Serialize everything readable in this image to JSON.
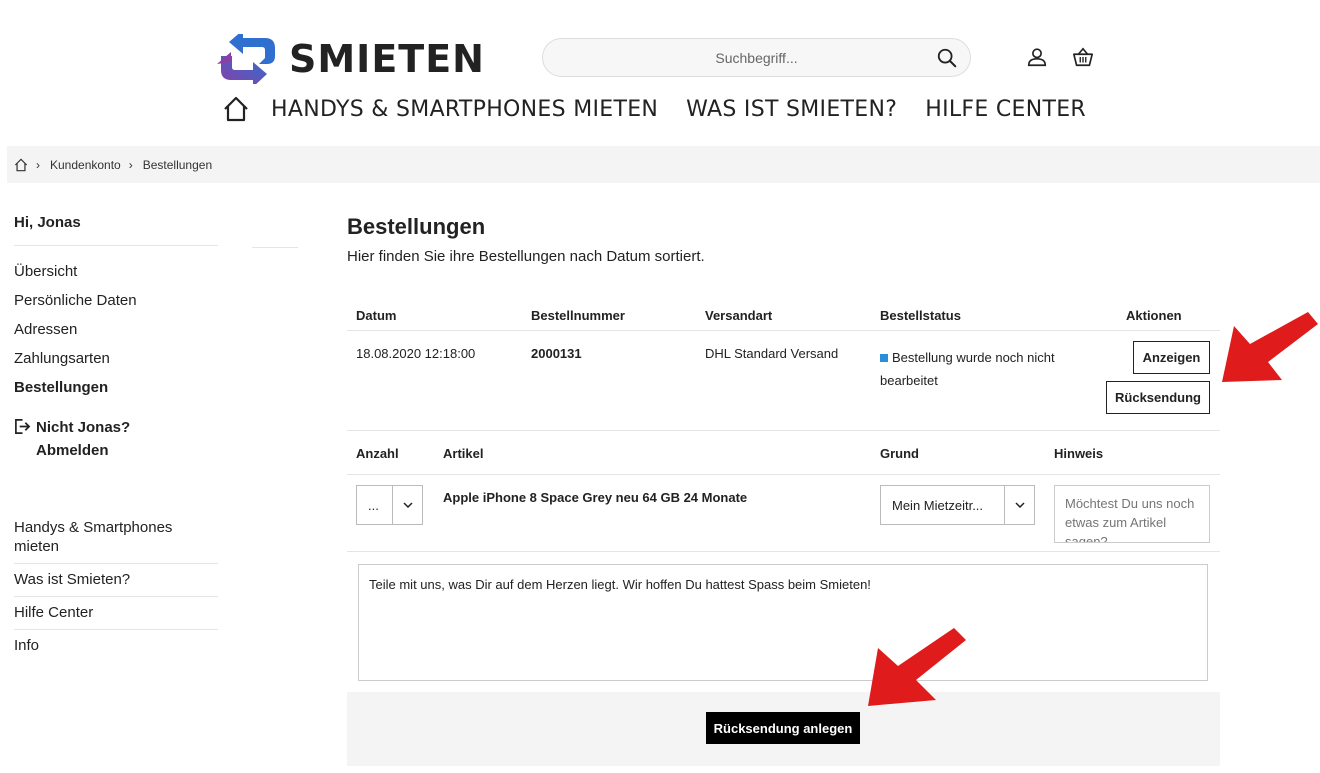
{
  "brand": {
    "name": "SMIETEN",
    "colors": {
      "purple": "#8a3fa6",
      "blue": "#2f6fd0",
      "red": "#e01b1b",
      "status_blue": "#2a8fd8"
    }
  },
  "search": {
    "placeholder": "Suchbegriff..."
  },
  "icons": {
    "search": "search-icon",
    "account": "user-icon",
    "cart": "basket-icon",
    "home": "home-icon"
  },
  "nav": {
    "items": [
      "HANDYS & SMARTPHONES MIETEN",
      "WAS IST SMIETEN?",
      "HILFE CENTER"
    ]
  },
  "breadcrumb": {
    "items": [
      "Kundenkonto",
      "Bestellungen"
    ]
  },
  "sidebar": {
    "greeting": "Hi, Jonas",
    "links": [
      "Übersicht",
      "Persönliche Daten",
      "Adressen",
      "Zahlungsarten",
      "Bestellungen"
    ],
    "active_link": "Bestellungen",
    "logout_line1": "Nicht Jonas?",
    "logout_line2": "Abmelden",
    "bottom_links": [
      "Handys & Smartphones mieten",
      "Was ist Smieten?",
      "Hilfe Center",
      "Info"
    ]
  },
  "main": {
    "title": "Bestellungen",
    "subtitle": "Hier finden Sie ihre Bestellungen nach Datum sortiert.",
    "orders_columns": [
      "Datum",
      "Bestellnummer",
      "Versandart",
      "Bestellstatus",
      "Aktionen"
    ],
    "order": {
      "date": "18.08.2020 12:18:00",
      "number": "2000131",
      "shipping": "DHL Standard Versand",
      "status_line1": "Bestellung wurde noch nicht",
      "status_line2": "bearbeitet",
      "action_view": "Anzeigen",
      "action_return": "Rücksendung"
    },
    "items_columns": [
      "Anzahl",
      "Artikel",
      "Grund",
      "Hinweis"
    ],
    "item": {
      "quantity": "...",
      "article": "Apple iPhone 8 Space Grey neu 64 GB 24 Monate",
      "reason": "Mein Mietzeitr...",
      "hint_placeholder": "Möchtest Du uns noch etwas zum Artikel sagen?"
    },
    "message": "Teile mit uns, was Dir auf dem Herzen liegt. Wir hoffen Du hattest Spass beim Smieten!",
    "submit_label": "Rücksendung anlegen"
  }
}
